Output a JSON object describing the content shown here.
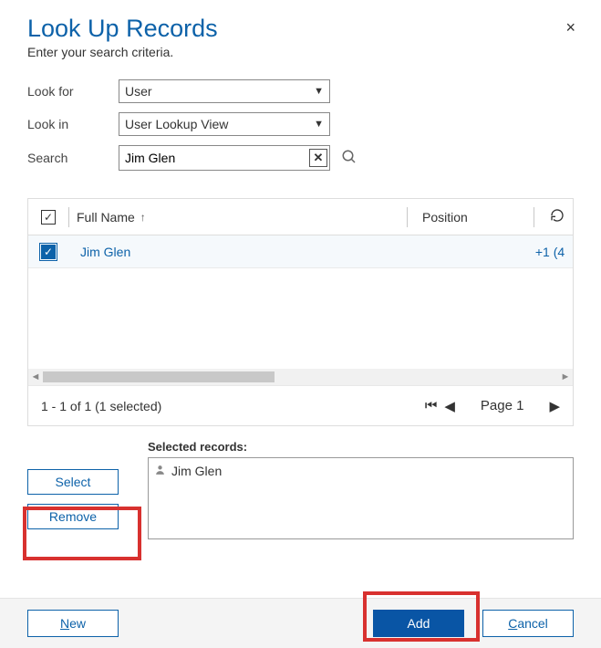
{
  "dialog": {
    "title": "Look Up Records",
    "subtitle": "Enter your search criteria.",
    "close_label": "×"
  },
  "form": {
    "look_for_label": "Look for",
    "look_for_value": "User",
    "look_in_label": "Look in",
    "look_in_value": "User Lookup View",
    "search_label": "Search",
    "search_value": "Jim Glen"
  },
  "grid": {
    "columns": {
      "fullname": "Full Name",
      "position": "Position"
    },
    "rows": [
      {
        "fullname": "Jim Glen",
        "position": "",
        "phone": "+1 (4"
      }
    ],
    "pager_status": "1 - 1 of 1 (1 selected)",
    "page_label": "Page 1"
  },
  "selected": {
    "label": "Selected records:",
    "records": [
      {
        "name": "Jim Glen"
      }
    ],
    "select_btn": "Select",
    "remove_btn": "Remove"
  },
  "footer": {
    "new_btn_prefix": "N",
    "new_btn_rest": "ew",
    "add_btn": "Add",
    "cancel_btn_prefix": "C",
    "cancel_btn_rest": "ancel"
  }
}
